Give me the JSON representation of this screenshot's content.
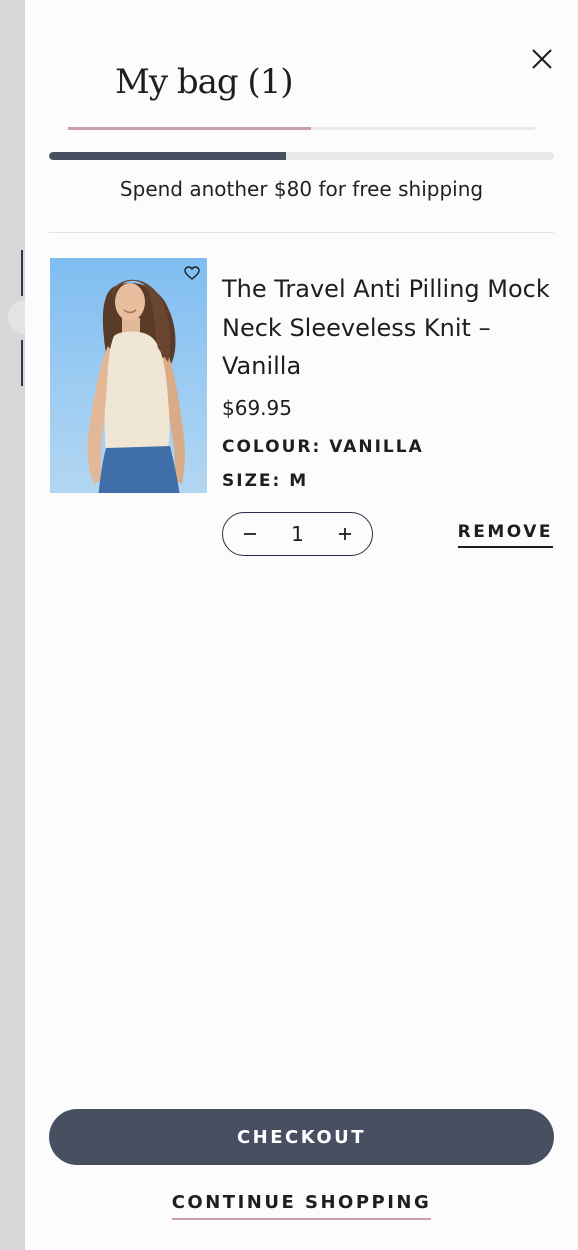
{
  "header": {
    "title": "My bag (1)",
    "active_tab_fraction": 0.52
  },
  "shipping": {
    "message": "Spend another $80 for free shipping",
    "progress_fraction": 0.47
  },
  "cart_item": {
    "name": "The Travel Anti Pilling Mock Neck Sleeveless Knit – Vanilla",
    "price": "$69.95",
    "colour": "COLOUR: VANILLA",
    "size": "SIZE: M",
    "quantity": "1",
    "remove_label": "REMOVE"
  },
  "footer": {
    "checkout_label": "CHECKOUT",
    "continue_label": "CONTINUE SHOPPING"
  },
  "colors": {
    "accent_dark": "#474f61",
    "accent_pink": "#c99fa5"
  },
  "icons": {
    "close": "close-icon",
    "wishlist": "heart-icon",
    "minus": "minus-icon",
    "plus": "plus-icon"
  }
}
